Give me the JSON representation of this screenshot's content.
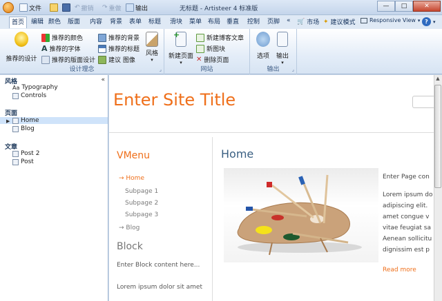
{
  "titlebar": {
    "file_menu": "文件",
    "undo_label": "撤销",
    "redo_label": "重做",
    "export_label": "输出",
    "title": "无标题 - Artisteer 4 标准版",
    "minimize": "—",
    "maximize": "□",
    "close": "✕"
  },
  "tabs": {
    "items": [
      "首页",
      "编辑",
      "颜色",
      "版面",
      "内容",
      "背景",
      "表单",
      "标题",
      "滑块",
      "菜单",
      "布局",
      "垂直",
      "控制",
      "页脚"
    ],
    "more": "«",
    "market": "市场",
    "suggest": "建议模式",
    "responsive": "Responsive View",
    "help": "?"
  },
  "ribbon": {
    "design": {
      "suggest_design": "推荐的设计",
      "suggest_color": "推荐的颜色",
      "suggest_font": "推荐的字体",
      "suggest_layout": "推荐的版面设计",
      "suggest_background": "推荐的背景",
      "suggest_header": "推荐的标题",
      "suggest_image": "建议 图像",
      "style": "风格",
      "group_label": "设计理念"
    },
    "site": {
      "new_page": "新建页面",
      "new_post": "新建博客文章",
      "new_block": "新图块",
      "delete_page": "删除页面",
      "group_label": "网站"
    },
    "export": {
      "options": "选项",
      "export": "输出",
      "group_label": "输出"
    }
  },
  "leftpanel": {
    "style_section": "风格",
    "collapse": "«",
    "style_items": [
      "Typography",
      "Controls"
    ],
    "pages_section": "页面",
    "page_items": [
      "Home",
      "Blog"
    ],
    "articles_section": "文章",
    "article_items": [
      "Post 2",
      "Post"
    ]
  },
  "canvas": {
    "site_title": "Enter Site Title",
    "vmenu_title": "VMenu",
    "menu": {
      "home": "→ Home",
      "sub1": "Subpage 1",
      "sub2": "Subpage 2",
      "sub3": "Subpage 3",
      "blog": "→ Blog"
    },
    "block_title": "Block",
    "block_text": "Enter Block content here...",
    "lorem": "Lorem ipsum dolor sit amet",
    "page_title": "Home",
    "side_lines": [
      "Enter Page con",
      "Lorem ipsum do",
      "adipiscing elit.",
      "amet congue v",
      "vitae feugiat sa",
      "Aenean sollicitu",
      "dignissim est p"
    ],
    "read_more": "Read more"
  },
  "colors": {
    "accent_orange": "#ef6f1a",
    "ribbon_blue": "#dfe9f5",
    "heading_blue": "#3a5f82"
  }
}
